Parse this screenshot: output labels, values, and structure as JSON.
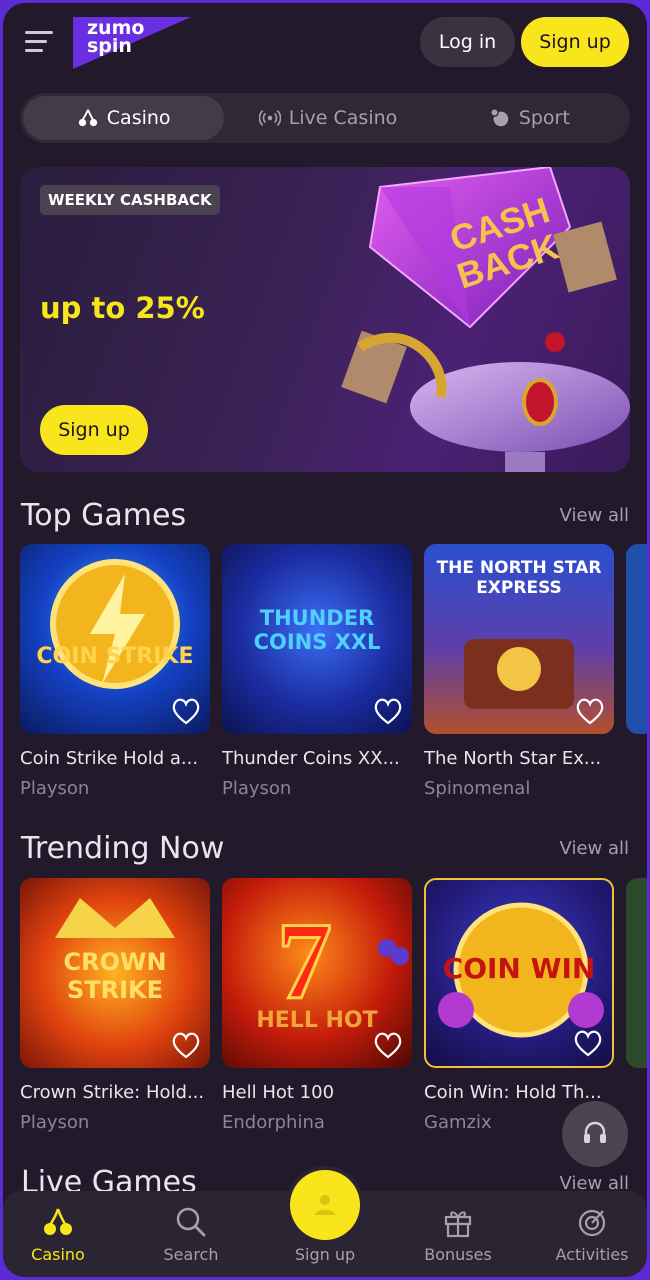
{
  "header": {
    "logo_text_line1": "zumo",
    "logo_text_line2": "spin",
    "login_label": "Log in",
    "signup_label": "Sign up"
  },
  "tabs": [
    {
      "label": "Casino",
      "icon": "cherries-icon",
      "active": true
    },
    {
      "label": "Live Casino",
      "icon": "broadcast-icon",
      "active": false
    },
    {
      "label": "Sport",
      "icon": "sport-ball-icon",
      "active": false
    }
  ],
  "banner": {
    "badge": "WEEKLY CASHBACK",
    "headline": "up to 25%",
    "button_label": "Sign up",
    "art_text_line1": "CASH",
    "art_text_line2": "BACK"
  },
  "top_games": {
    "title": "Top Games",
    "view_all": "View all",
    "games": [
      {
        "name": "Coin Strike Hold a...",
        "provider": "Playson",
        "art": "COIN STRIKE"
      },
      {
        "name": "Thunder Coins XX...",
        "provider": "Playson",
        "art": "THUNDER COINS XXL"
      },
      {
        "name": "The North Star Ex...",
        "provider": "Spinomenal",
        "art": "THE NORTH STAR EXPRESS"
      }
    ]
  },
  "trending": {
    "title": "Trending Now",
    "view_all": "View all",
    "games": [
      {
        "name": "Crown Strike: Hold...",
        "provider": "Playson",
        "art": "CROWN STRIKE"
      },
      {
        "name": "Hell Hot 100",
        "provider": "Endorphina",
        "art": "HELL HOT"
      },
      {
        "name": "Coin Win: Hold Th...",
        "provider": "Gamzix",
        "art": "COIN WIN"
      }
    ]
  },
  "live_games": {
    "title": "Live Games",
    "view_all": "View all"
  },
  "bottom_nav": [
    {
      "label": "Casino",
      "icon": "cherries-icon",
      "active": true
    },
    {
      "label": "Search",
      "icon": "search-icon",
      "active": false
    },
    {
      "label": "Sign up",
      "icon": "user-icon",
      "active": false
    },
    {
      "label": "Bonuses",
      "icon": "gift-icon",
      "active": false
    },
    {
      "label": "Activities",
      "icon": "target-icon",
      "active": false
    }
  ],
  "colors": {
    "accent": "#f8e51c",
    "background": "#221a2b",
    "frame": "#5b2bd6"
  }
}
